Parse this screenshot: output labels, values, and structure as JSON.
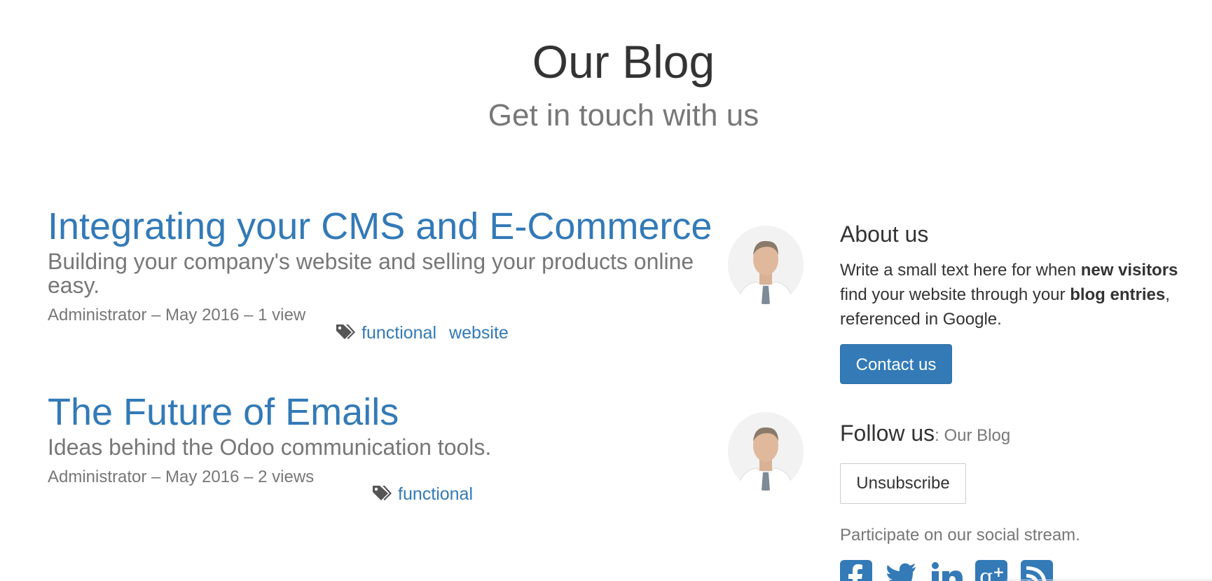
{
  "header": {
    "title": "Our Blog",
    "subtitle": "Get in touch with us"
  },
  "posts": [
    {
      "title": "Integrating your CMS and E-Commerce",
      "subtitle": "Building your company's website and selling your products online easy.",
      "meta": "Administrator – May 2016 – 1 view",
      "tags": [
        "functional",
        "website"
      ]
    },
    {
      "title": "The Future of Emails",
      "subtitle": "Ideas behind the Odoo communication tools.",
      "meta": "Administrator – May 2016 – 2 views",
      "tags": [
        "functional"
      ]
    }
  ],
  "sidebar": {
    "about_heading": "About us",
    "about_text_1": "Write a small text here for when ",
    "about_bold_1": "new visitors",
    "about_text_2": " find your website through your ",
    "about_bold_2": "blog entries",
    "about_text_3": ", referenced in Google.",
    "contact_label": "Contact us",
    "follow_heading": "Follow us",
    "follow_sub": ": Our Blog",
    "unsubscribe_label": "Unsubscribe",
    "participate_text": "Participate on our social stream.",
    "social_icons": [
      "facebook-icon",
      "twitter-icon",
      "linkedin-icon",
      "google-plus-icon",
      "rss-icon"
    ]
  },
  "colors": {
    "link": "#337ab7",
    "muted": "#777777",
    "text": "#333333"
  }
}
